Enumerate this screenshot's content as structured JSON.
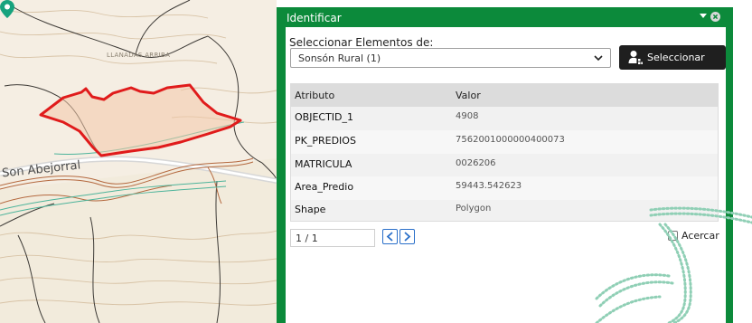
{
  "map": {
    "place_label": "LLANADAS ARRIBA",
    "road_label": "Son  Abejorral"
  },
  "panel": {
    "title": "Identificar",
    "select_label": "Seleccionar Elementos de:",
    "layer_select": {
      "value": "Sonsón Rural (1)"
    },
    "select_button": {
      "label": "Seleccionar",
      "icon": "user-select-icon"
    },
    "table": {
      "columns": [
        "Atributo",
        "Valor"
      ],
      "rows": [
        {
          "attr": "OBJECTID_1",
          "value": "4908"
        },
        {
          "attr": "PK_PREDIOS",
          "value": "7562001000000400073"
        },
        {
          "attr": "MATRICULA",
          "value": "0026206"
        },
        {
          "attr": "Area_Predio",
          "value": "59443.542623"
        },
        {
          "attr": "Shape",
          "value": "Polygon"
        }
      ]
    },
    "pager": {
      "page_value": "1 / 1"
    },
    "zoom_checkbox_label": "Acercar",
    "colors": {
      "header_green": "#0c8a3b",
      "button_dark": "#1f1f1f",
      "parcel_outline": "#e01b1b",
      "pin": "#17a37e"
    }
  }
}
